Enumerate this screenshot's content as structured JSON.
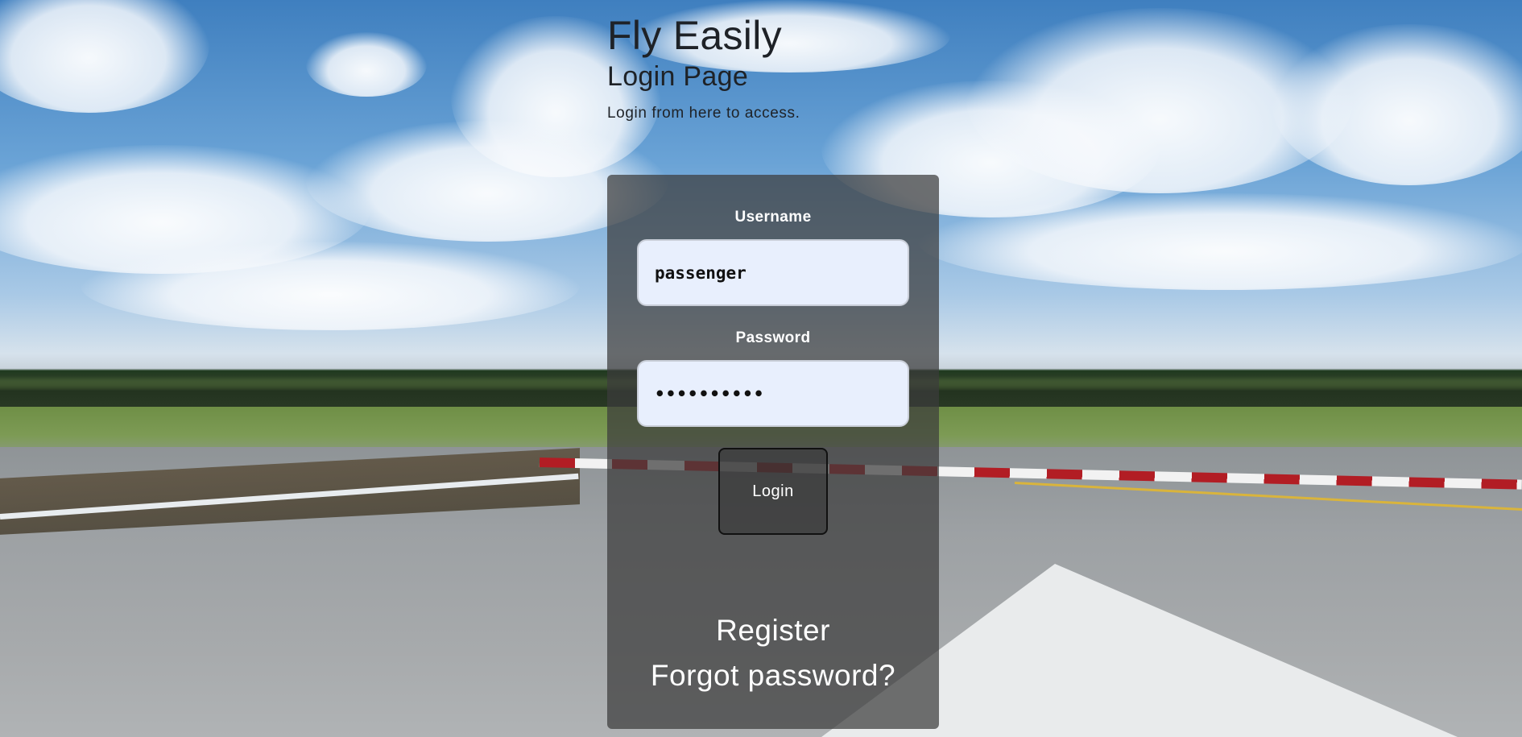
{
  "header": {
    "app_title": "Fly Easily",
    "page_title": "Login Page",
    "subtitle": "Login from here to access."
  },
  "form": {
    "username_label": "Username",
    "username_value": "passenger",
    "password_label": "Password",
    "password_value": "••••••••••",
    "login_label": "Login"
  },
  "links": {
    "register": "Register",
    "forgot_password": "Forgot password?"
  },
  "colors": {
    "card_background": "#3c3c3c",
    "input_background": "#e8effd",
    "text_dark": "#1e2227",
    "text_light": "#ffffff"
  }
}
